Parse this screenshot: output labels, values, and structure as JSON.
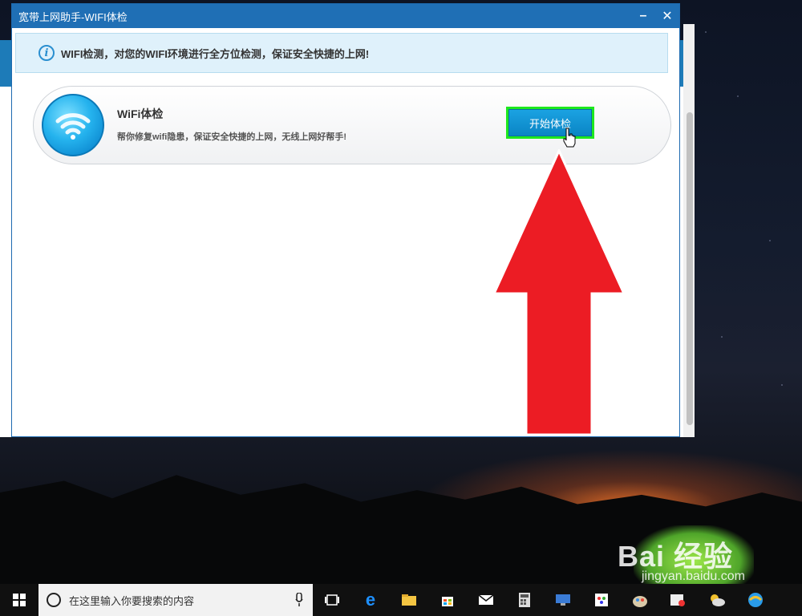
{
  "window": {
    "title": "宽带上网助手-WIFI体检",
    "minimize_glyph": "–",
    "close_glyph": "✕"
  },
  "info_bar": {
    "icon_glyph": "i",
    "text": "WIFI检测，对您的WIFI环境进行全方位检测，保证安全快捷的上网!"
  },
  "card": {
    "title": "WiFi体检",
    "description": "帮你修复wifi隐患，保证安全快捷的上网，无线上网好帮手!",
    "button_label": "开始体检"
  },
  "taskbar": {
    "search_placeholder": "在这里输入你要搜索的内容",
    "icons": [
      "task-view-icon",
      "edge-icon",
      "file-explorer-icon",
      "store-icon",
      "mail-icon",
      "calculator-icon",
      "network-icon",
      "paint-icon",
      "app-icon",
      "media-icon",
      "weather-icon",
      "browser-icon"
    ]
  },
  "watermark": {
    "brand": "Bai 经验",
    "url": "jingyan.baidu.com"
  },
  "colors": {
    "titlebar": "#1f6fb5",
    "info_bg": "#dff1fb",
    "button": "#0d8fcf",
    "highlight": "#1ee81e",
    "arrow": "#ec1c24"
  }
}
